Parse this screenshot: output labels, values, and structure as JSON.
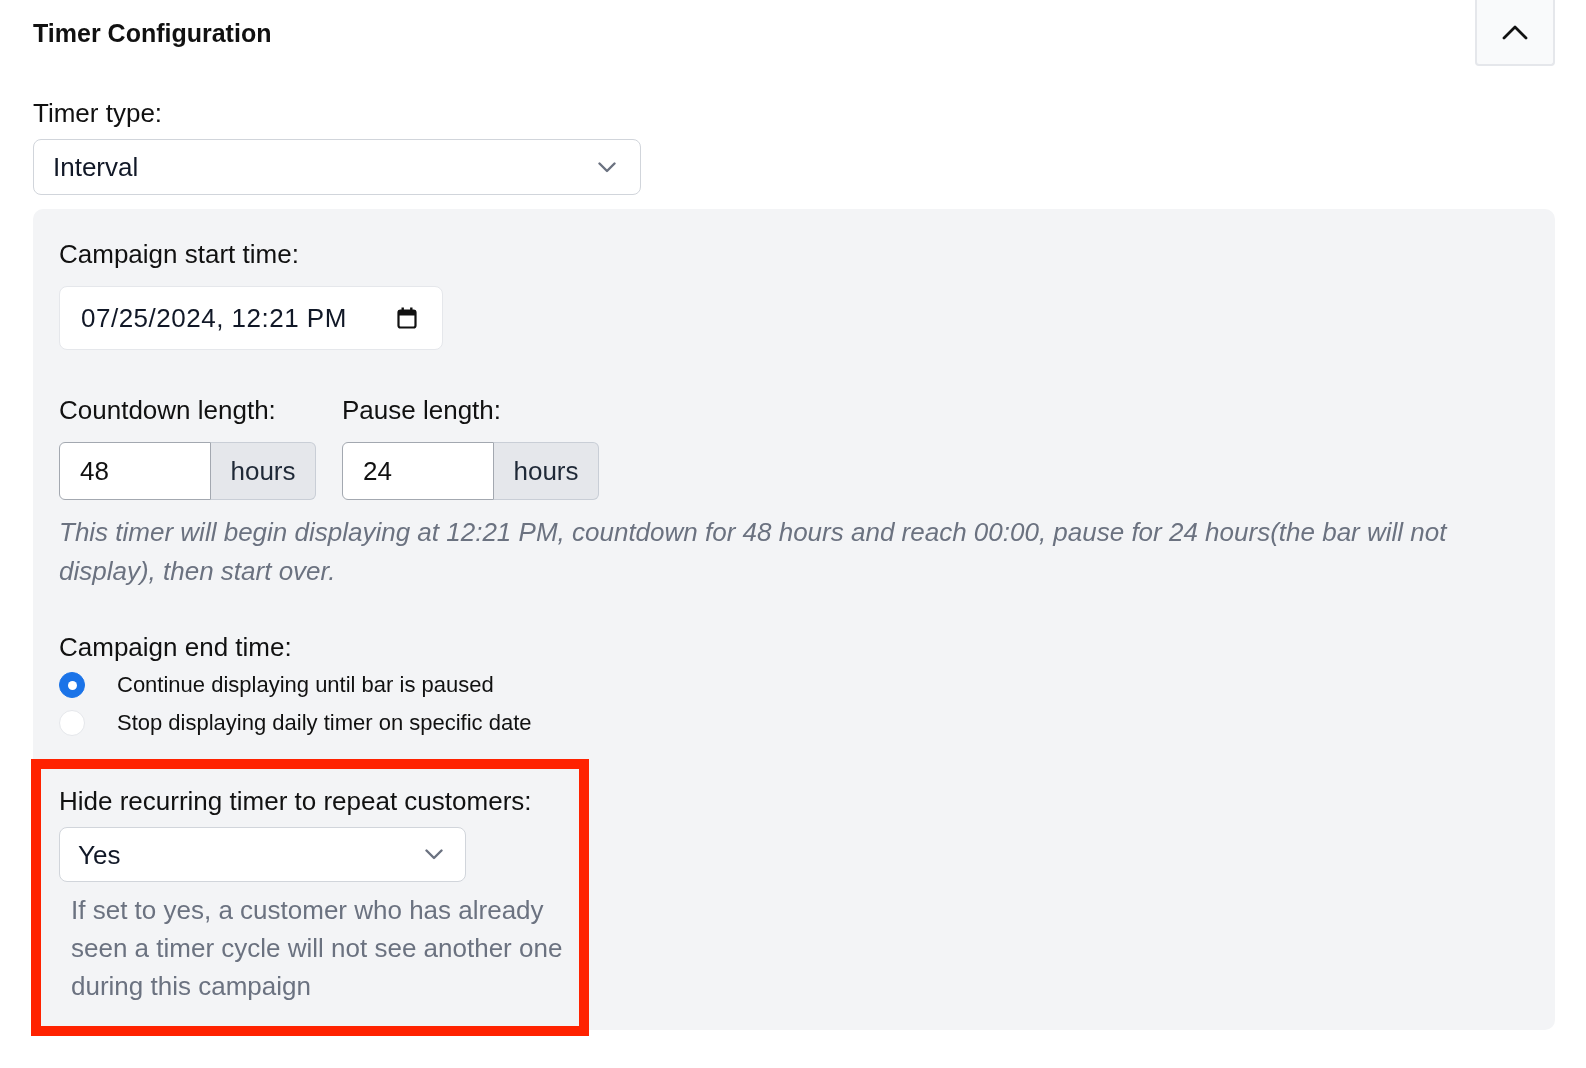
{
  "header": {
    "title": "Timer Configuration",
    "collapse_button": {
      "expanded": true
    }
  },
  "timer_type": {
    "label": "Timer type:",
    "value": "Interval"
  },
  "settings_panel": {
    "start_time": {
      "label": "Campaign start time:",
      "value": "07/25/2024, 12:21 PM"
    },
    "durations": [
      {
        "label": "Countdown length:",
        "value": "48",
        "unit": "hours"
      },
      {
        "label": "Pause length:",
        "value": "24",
        "unit": "hours"
      }
    ],
    "summary": "This timer will begin displaying at 12:21 PM, countdown for 48 hours and reach 00:00, pause for 24 hours(the bar will not display), then start over.",
    "end_time": {
      "label": "Campaign end time:",
      "options": [
        {
          "label": "Continue displaying until bar is paused",
          "selected": true
        },
        {
          "label": "Stop displaying daily timer on specific date",
          "selected": false
        }
      ]
    },
    "hide_repeat": {
      "highlighted": true,
      "label": "Hide recurring timer to repeat customers:",
      "value": "Yes",
      "help": "If set to yes, a customer who has already seen a timer cycle will not see another one during this campaign"
    }
  }
}
